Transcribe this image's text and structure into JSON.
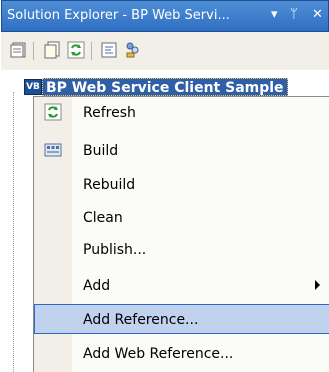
{
  "title_bar": {
    "title": "Solution Explorer - BP Web Servi...",
    "dropdown_glyph": "▾",
    "pin_glyph": "ᛘ",
    "close_glyph": "✕"
  },
  "toolbar": {
    "icons": [
      "properties-icon",
      "show-all-files-icon",
      "refresh-icon",
      "view-code-icon",
      "view-designer-icon"
    ]
  },
  "tree": {
    "project_label": "BP Web Service Client Sample",
    "project_icon": "vb-project-icon"
  },
  "context_menu": {
    "items": [
      {
        "label": "Refresh",
        "icon": "refresh-icon"
      },
      {
        "label": "Build",
        "icon": "build-icon"
      },
      {
        "label": "Rebuild",
        "icon": ""
      },
      {
        "label": "Clean",
        "icon": ""
      },
      {
        "label": "Publish...",
        "icon": ""
      },
      {
        "label": "Add",
        "icon": "",
        "submenu": true
      },
      {
        "label": "Add Reference...",
        "icon": "",
        "highlighted": true
      },
      {
        "label": "Add Web Reference...",
        "icon": ""
      }
    ]
  },
  "colors": {
    "titlebar": "#2f6fc2",
    "highlight": "#c1d2ee",
    "selection": "#2f5fa8"
  }
}
